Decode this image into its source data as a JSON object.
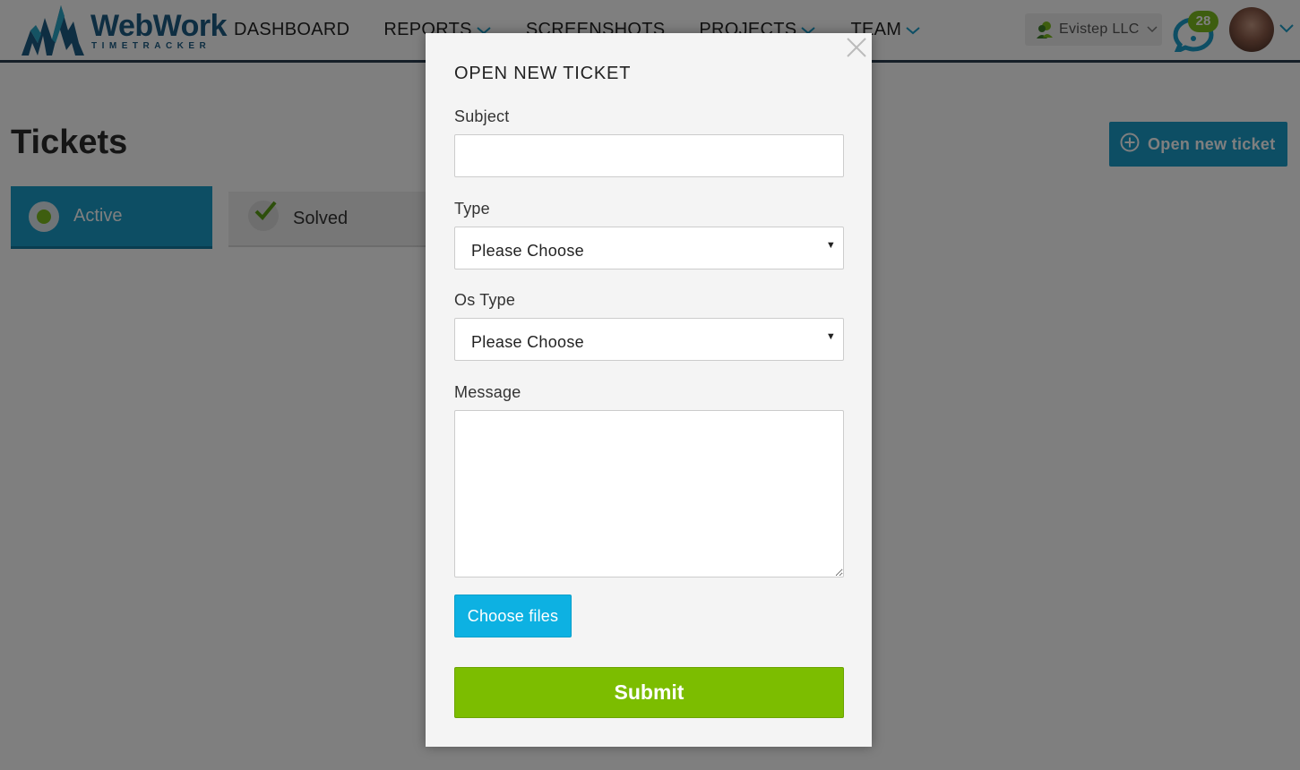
{
  "brand": {
    "name": "WebWork",
    "subtitle": "TIMETRACKER",
    "color": "#1d5c85"
  },
  "nav": {
    "items": [
      {
        "label": "DASHBOARD",
        "has_dropdown": false
      },
      {
        "label": "REPORTS",
        "has_dropdown": true
      },
      {
        "label": "SCREENSHOTS",
        "has_dropdown": false
      },
      {
        "label": "PROJECTS",
        "has_dropdown": true
      },
      {
        "label": "TEAM",
        "has_dropdown": true
      }
    ]
  },
  "header": {
    "company": "Evistep  LLC",
    "messages_badge": "28",
    "accent": "#1a9cc8",
    "badge_color": "#7cbd1e"
  },
  "page": {
    "title": "Tickets",
    "open_ticket_button": "Open  new  ticket",
    "tabs": [
      {
        "label": "Active",
        "state": "selected"
      },
      {
        "label": "Solved",
        "state": "normal"
      }
    ]
  },
  "modal": {
    "title": "OPEN  NEW  TICKET",
    "subject": {
      "label": "Subject",
      "value": ""
    },
    "type": {
      "label": "Type",
      "selected": "Please  Choose"
    },
    "os_type": {
      "label": "Os  Type",
      "selected": "Please  Choose"
    },
    "message": {
      "label": "Message",
      "value": ""
    },
    "choose_files_label": "Choose  files",
    "submit_label": "Submit",
    "submit_color": "#7cbd00",
    "files_color": "#0db1e2"
  }
}
